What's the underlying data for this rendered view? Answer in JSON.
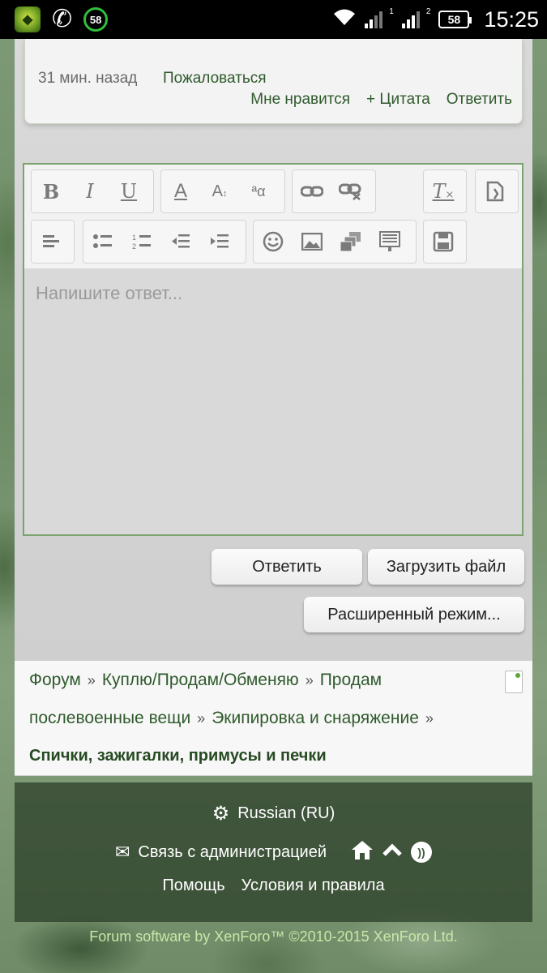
{
  "status_bar": {
    "notification_badge": "58",
    "signal_1": "1",
    "signal_2": "2",
    "battery": "58",
    "time": "15:25"
  },
  "post": {
    "time": "31 мин. назад",
    "report": "Пожаловаться",
    "like": "Мне нравится",
    "quote": "+ Цитата",
    "reply": "Ответить"
  },
  "editor": {
    "placeholder": "Напишите ответ...",
    "toolbar_icons": [
      "bold-icon",
      "italic-icon",
      "underline-icon",
      "font-color-icon",
      "font-size-icon",
      "font-family-icon",
      "link-icon",
      "unlink-icon",
      "remove-format-icon",
      "toggle-bbcode-icon",
      "align-icon",
      "unordered-list-icon",
      "ordered-list-icon",
      "outdent-icon",
      "indent-icon",
      "smilies-icon",
      "image-icon",
      "media-icon",
      "code-icon",
      "save-draft-icon"
    ]
  },
  "buttons": {
    "reply": "Ответить",
    "upload": "Загрузить файл",
    "advanced": "Расширенный режим..."
  },
  "breadcrumb": {
    "items": [
      "Форум",
      "Куплю/Продам/Обменяю",
      "Продам",
      "послевоенные вещи",
      "Экипировка и снаряжение"
    ],
    "separator": "»",
    "current": "Спички, зажигалки, примусы и печки"
  },
  "footer": {
    "language": "Russian (RU)",
    "contact": "Связь с администрацией",
    "help": "Помощь",
    "terms": "Условия и правила",
    "copyright": "Forum software by XenForo™ ©2010-2015 XenForo Ltd."
  },
  "colors": {
    "link_green": "#2f5a2c",
    "editor_border": "#7aa36f"
  }
}
